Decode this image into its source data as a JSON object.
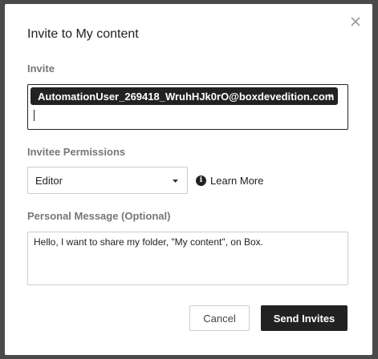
{
  "dialog": {
    "title": "Invite to My content",
    "close_icon": "close-icon"
  },
  "invite": {
    "label": "Invite",
    "recipients": [
      {
        "email": "AutomationUser_269418_WruhHJk0rO@boxdevedition.com",
        "remove_label": "×"
      }
    ],
    "input_value": ""
  },
  "permissions": {
    "label": "Invitee Permissions",
    "selected": "Editor",
    "dropdown_icon": "caret-down-icon",
    "info_icon": "info-icon",
    "info_glyph": "i",
    "learn_more": "Learn More"
  },
  "message": {
    "label": "Personal Message (Optional)",
    "value": "Hello, I want to share my folder, \"My content\", on Box."
  },
  "actions": {
    "cancel": "Cancel",
    "send": "Send Invites"
  },
  "colors": {
    "primary": "#222222",
    "label_gray": "#777777",
    "border": "#cccccc",
    "backdrop": "#4a4a4a"
  }
}
